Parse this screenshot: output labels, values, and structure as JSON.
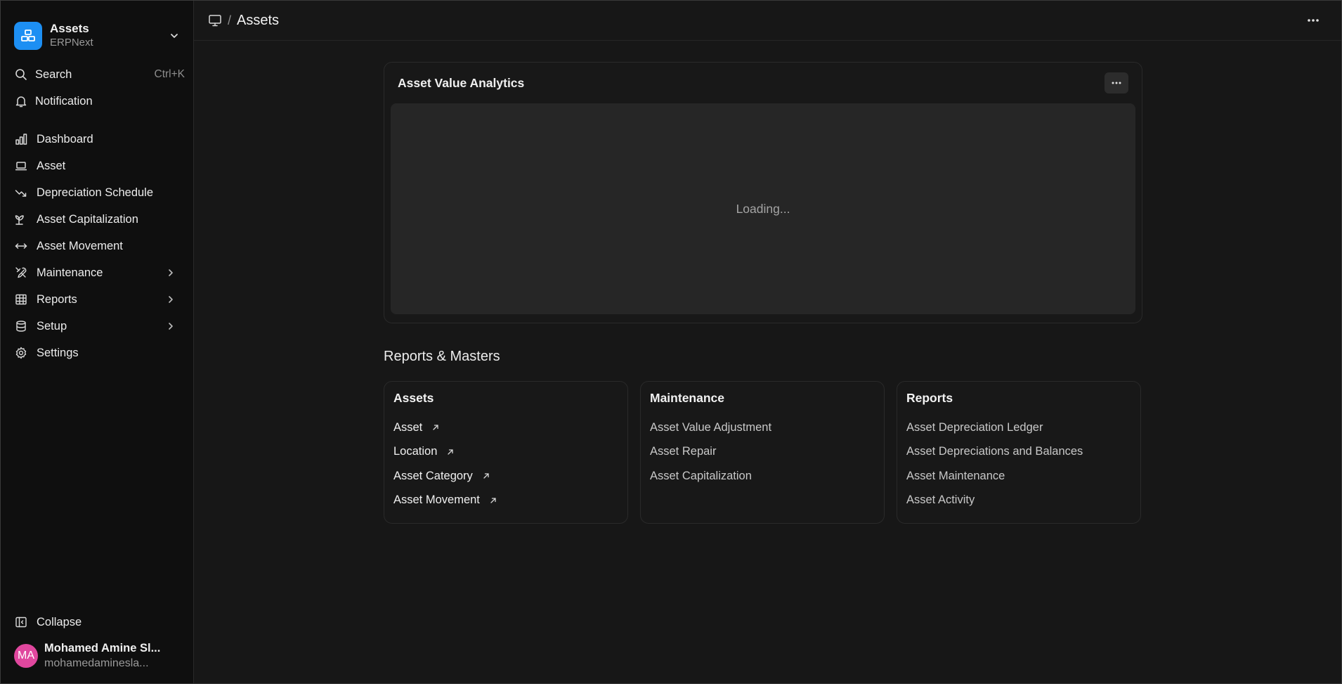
{
  "brand": {
    "title": "Assets",
    "subtitle": "ERPNext",
    "color": "#1d8ff3"
  },
  "sidebar": {
    "search": {
      "label": "Search",
      "shortcut": "Ctrl+K"
    },
    "notification": {
      "label": "Notification"
    },
    "items": [
      {
        "label": "Dashboard",
        "icon": "bar-chart-icon"
      },
      {
        "label": "Asset",
        "icon": "laptop-icon"
      },
      {
        "label": "Depreciation Schedule",
        "icon": "trending-down-icon"
      },
      {
        "label": "Asset Capitalization",
        "icon": "sprout-icon"
      },
      {
        "label": "Asset Movement",
        "icon": "move-horizontal-icon"
      },
      {
        "label": "Maintenance",
        "icon": "tools-icon",
        "expandable": true
      },
      {
        "label": "Reports",
        "icon": "table-icon",
        "expandable": true
      },
      {
        "label": "Setup",
        "icon": "database-icon",
        "expandable": true
      },
      {
        "label": "Settings",
        "icon": "gear-icon"
      }
    ],
    "collapse_label": "Collapse",
    "user": {
      "initials": "MA",
      "name": "Mohamed Amine Sl...",
      "email": "mohamedaminesla...",
      "avatar_color": "#e0479e"
    }
  },
  "topbar": {
    "separator": "/",
    "title": "Assets"
  },
  "chart_card": {
    "title": "Asset Value Analytics",
    "loading_text": "Loading..."
  },
  "reports_section": {
    "title": "Reports & Masters",
    "cards": [
      {
        "title": "Assets",
        "links": [
          "Asset",
          "Location",
          "Asset Category",
          "Asset Movement"
        ],
        "external": true
      },
      {
        "title": "Maintenance",
        "links": [
          "Asset Value Adjustment",
          "Asset Repair",
          "Asset Capitalization"
        ],
        "external": false
      },
      {
        "title": "Reports",
        "links": [
          "Asset Depreciation Ledger",
          "Asset Depreciations and Balances",
          "Asset Maintenance",
          "Asset Activity"
        ],
        "external": false
      }
    ]
  }
}
